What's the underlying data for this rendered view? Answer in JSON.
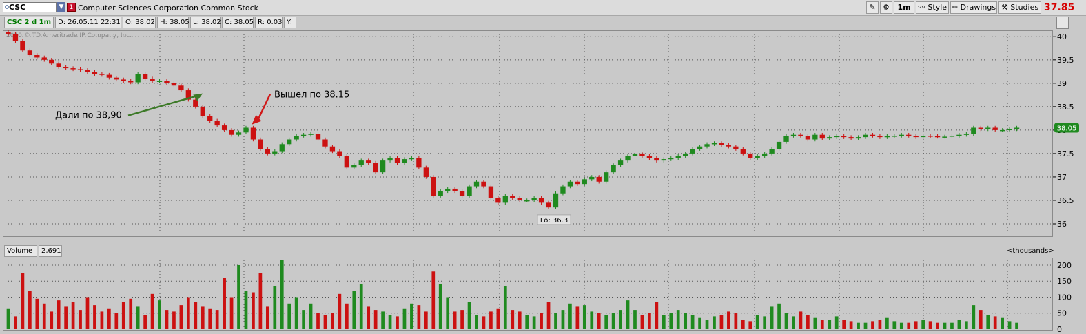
{
  "toolbar": {
    "symbol": "CSC",
    "company": "Computer Sciences Corporation Common Stock",
    "timeframe": "1m",
    "style_label": "Style",
    "drawings_label": "Drawings",
    "studies_label": "Studies",
    "last_price": "37.85"
  },
  "info": {
    "title": "CSC 2 d 1m",
    "date": "D: 26.05.11 22:31",
    "open": "O: 38.02",
    "high": "H: 38.05",
    "low": "L: 38.02",
    "close": "C: 38.05",
    "range": "R: 0.03",
    "y": "Y:"
  },
  "copyright": "2010 © TD Ameritrade IP Company, Inc.",
  "volume_bar": {
    "label": "Volume",
    "value": "2,691",
    "units": "<thousands>"
  },
  "colors": {
    "up": "#1f8a1f",
    "down": "#cc1111",
    "grid": "#555555",
    "arrow_green": "#3d7a28",
    "arrow_red": "#d01818",
    "last_price_box": "#1f8a1f"
  },
  "chart_data": [
    {
      "type": "candlestick",
      "y_ticks": [
        36,
        36.5,
        37,
        37.5,
        38,
        38.5,
        39,
        39.5,
        40
      ],
      "y_tick_labels": [
        "36",
        "36.5",
        "37",
        "37.5",
        "38",
        "38.5",
        "39",
        "39.5",
        "40"
      ],
      "ylim": [
        35.75,
        40.1
      ],
      "current_price_label": "38.05",
      "low_label": "Lo: 36.3",
      "annotations": [
        {
          "text": "Дали по 38,90",
          "target_price": 38.9,
          "arrow": "green"
        },
        {
          "text": "Вышел по 38.15",
          "target_price": 38.15,
          "arrow": "red"
        }
      ],
      "closes": [
        40.05,
        39.9,
        39.7,
        39.6,
        39.55,
        39.5,
        39.42,
        39.35,
        39.32,
        39.3,
        39.28,
        39.24,
        39.2,
        39.18,
        39.12,
        39.08,
        39.05,
        39.02,
        39.2,
        39.1,
        39.05,
        39.05,
        39.0,
        38.95,
        38.85,
        38.65,
        38.5,
        38.3,
        38.2,
        38.1,
        38.0,
        37.9,
        37.95,
        38.05,
        37.8,
        37.6,
        37.5,
        37.55,
        37.7,
        37.8,
        37.88,
        37.9,
        37.92,
        37.8,
        37.65,
        37.55,
        37.45,
        37.2,
        37.25,
        37.35,
        37.3,
        37.1,
        37.35,
        37.4,
        37.3,
        37.38,
        37.4,
        37.2,
        37.0,
        36.6,
        36.7,
        36.75,
        36.7,
        36.6,
        36.8,
        36.9,
        36.8,
        36.55,
        36.45,
        36.6,
        36.55,
        36.5,
        36.5,
        36.55,
        36.45,
        36.35,
        36.65,
        36.8,
        36.9,
        36.85,
        36.95,
        37.0,
        36.9,
        37.1,
        37.25,
        37.35,
        37.45,
        37.5,
        37.45,
        37.4,
        37.35,
        37.38,
        37.4,
        37.45,
        37.5,
        37.6,
        37.65,
        37.7,
        37.72,
        37.68,
        37.65,
        37.6,
        37.5,
        37.4,
        37.45,
        37.5,
        37.6,
        37.75,
        37.88,
        37.9,
        37.88,
        37.8,
        37.9,
        37.82,
        37.85,
        37.88,
        37.85,
        37.82,
        37.85,
        37.9,
        37.88,
        37.85,
        37.87,
        37.88,
        37.9,
        37.88,
        37.85,
        37.88,
        37.87,
        37.86,
        37.86,
        37.88,
        37.9,
        37.92,
        38.05,
        38.02,
        38.05,
        38.0,
        38.0,
        38.02,
        38.05
      ],
      "volume": {
        "ylim": [
          0,
          215
        ],
        "y_ticks": [
          0,
          50,
          100,
          150,
          200
        ],
        "y_tick_labels": [
          "0",
          "50",
          "100",
          "150",
          "200"
        ],
        "values": [
          65,
          40,
          175,
          120,
          95,
          80,
          55,
          90,
          70,
          85,
          60,
          100,
          75,
          55,
          65,
          50,
          85,
          95,
          70,
          45,
          110,
          90,
          60,
          55,
          75,
          100,
          85,
          70,
          65,
          60,
          160,
          100,
          200,
          120,
          115,
          175,
          70,
          135,
          215,
          80,
          100,
          60,
          80,
          50,
          45,
          50,
          110,
          80,
          120,
          140,
          70,
          60,
          55,
          45,
          40,
          65,
          80,
          75,
          55,
          180,
          140,
          100,
          55,
          60,
          85,
          45,
          40,
          55,
          65,
          135,
          60,
          55,
          45,
          40,
          50,
          85,
          50,
          60,
          80,
          70,
          75,
          55,
          50,
          45,
          50,
          60,
          90,
          60,
          45,
          50,
          85,
          45,
          50,
          60,
          50,
          45,
          35,
          30,
          40,
          45,
          55,
          50,
          30,
          25,
          45,
          40,
          70,
          80,
          50,
          40,
          55,
          45,
          35,
          30,
          30,
          40,
          30,
          25,
          20,
          20,
          25,
          30,
          35,
          25,
          20,
          20,
          25,
          30,
          25,
          20,
          20,
          20,
          30,
          25,
          75,
          60,
          45,
          40,
          35,
          25,
          20
        ]
      }
    }
  ]
}
